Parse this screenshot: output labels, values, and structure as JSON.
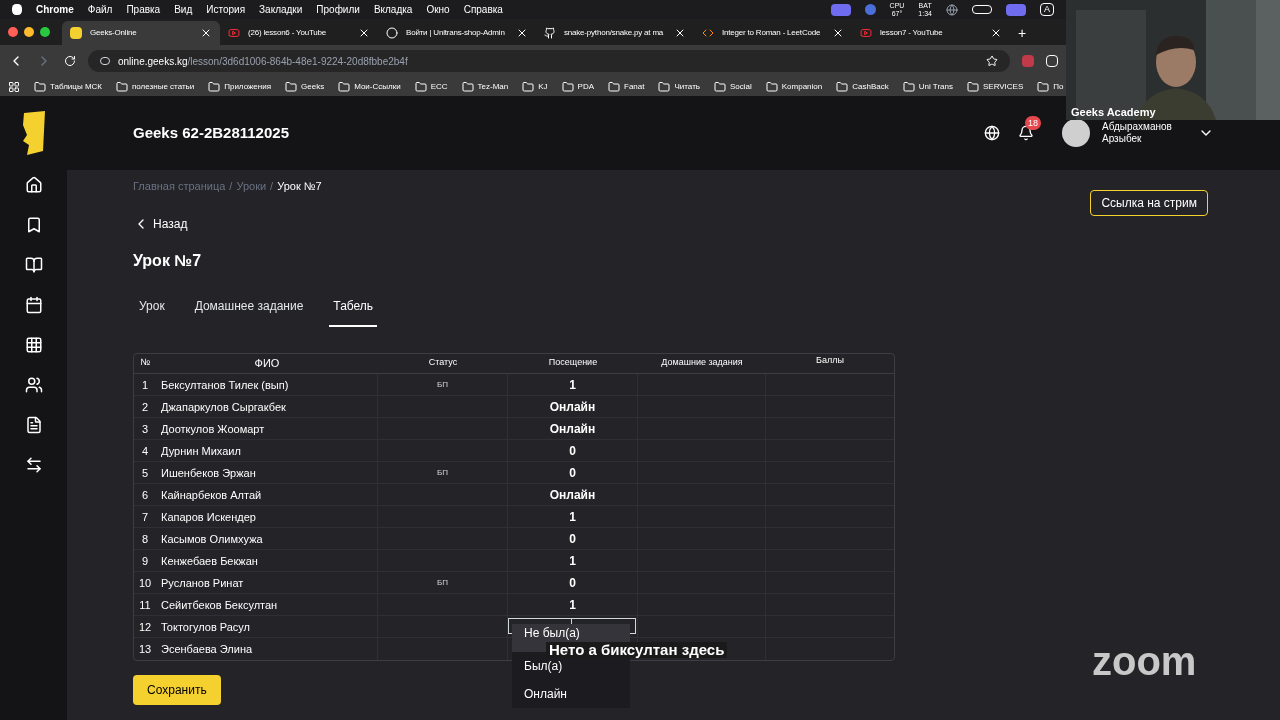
{
  "menubar": {
    "items": [
      "Chrome",
      "Файл",
      "Правка",
      "Вид",
      "История",
      "Закладки",
      "Профили",
      "Вкладка",
      "Окно",
      "Справка"
    ],
    "cpu": {
      "label": "CPU",
      "value": "67°"
    },
    "battery": {
      "label": "BAT",
      "value": "1:34"
    },
    "input_source": "A"
  },
  "browser": {
    "tabs": [
      {
        "title": "Geeks-Online",
        "selected": true
      },
      {
        "title": "(26) lesson6 - YouTube",
        "selected": false
      },
      {
        "title": "Войти | Unitrans-shop-Admin",
        "selected": false
      },
      {
        "title": "snake-python/snake.py at ma",
        "selected": false
      },
      {
        "title": "Integer to Roman - LeetCode",
        "selected": false
      },
      {
        "title": "lesson7 - YouTube",
        "selected": false
      }
    ],
    "new_tab": "+",
    "address": {
      "host": "online.geeks.kg",
      "path": "/lesson/3d6d1006-864b-48e1-9224-20d8fbbe2b4f"
    },
    "bookmarks": [
      "Таблицы МСК",
      "полезные статьи",
      "Приложения",
      "Geeks",
      "Мои-Ссылки",
      "ECC",
      "Tez-Man",
      "KJ",
      "PDA",
      "Fanat",
      "Читать",
      "Social",
      "Kompanion",
      "CashBack",
      "Uni Trans",
      "SERVICES",
      "По"
    ]
  },
  "header": {
    "title": "Geeks 62-2B28112025",
    "notifications": "18",
    "user": {
      "first": "Абдырахманов",
      "last": "Арзыбек"
    }
  },
  "stream_button": "Ссылка на стрим",
  "breadcrumbs": [
    {
      "label": "Главная страница",
      "current": false
    },
    {
      "label": "Уроки",
      "current": false
    },
    {
      "label": "Урок №7",
      "current": true
    }
  ],
  "separator": "/",
  "back": "Назад",
  "page_title": "Урок №7",
  "tabs": [
    {
      "label": "Урок",
      "selected": false
    },
    {
      "label": "Домашнее задание",
      "selected": false
    },
    {
      "label": "Табель",
      "selected": true
    }
  ],
  "table": {
    "columns": [
      "№",
      "ФИО",
      "Статус",
      "Посещение",
      "Домашние задания",
      "Баллы"
    ],
    "rows": [
      {
        "num": "1",
        "name": "Бексултанов Тилек (вып)",
        "status": "БП",
        "attendance": "1",
        "kind": "text"
      },
      {
        "num": "2",
        "name": "Джапаркулов Сыргакбек",
        "attendance": "Онлайн",
        "kind": "text"
      },
      {
        "num": "3",
        "name": "Дооткулов Жоомарт",
        "attendance": "Онлайн",
        "kind": "text"
      },
      {
        "num": "4",
        "name": "Дурнин Михаил",
        "attendance": "0",
        "kind": "text"
      },
      {
        "num": "5",
        "name": "Ишенбеков Эржан",
        "status": "БП",
        "attendance": "0",
        "kind": "text"
      },
      {
        "num": "6",
        "name": "Кайнарбеков Алтай",
        "attendance": "Онлайн",
        "kind": "text"
      },
      {
        "num": "7",
        "name": "Капаров Искендер",
        "attendance": "1",
        "kind": "text"
      },
      {
        "num": "8",
        "name": "Касымов Олимхужа",
        "attendance": "0",
        "kind": "text"
      },
      {
        "num": "9",
        "name": "Кенжебаев Бекжан",
        "attendance": "1",
        "kind": "text"
      },
      {
        "num": "10",
        "name": "Русланов Ринат",
        "status": "БП",
        "attendance": "0",
        "kind": "text"
      },
      {
        "num": "11",
        "name": "Сейитбеков Бексултан",
        "attendance": "1",
        "kind": "text"
      },
      {
        "num": "12",
        "name": "Токтогулов Расул",
        "kind": "select"
      },
      {
        "num": "13",
        "name": "Эсенбаева Элина",
        "kind": "text"
      }
    ]
  },
  "attendance_menu": [
    {
      "label": "Не был(а)",
      "selected": true
    },
    {
      "label": "Был(а)",
      "selected": false
    },
    {
      "label": "Онлайн",
      "selected": false
    }
  ],
  "save_button": "Сохранить",
  "video": {
    "name": "Geeks Academy"
  },
  "caption": "Нето а биксултан здесь",
  "zoom_logo": "zoom"
}
